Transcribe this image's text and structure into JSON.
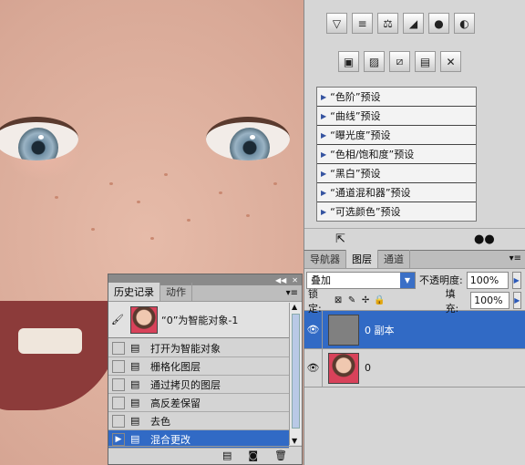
{
  "adjustments": {
    "row1_icons": [
      "levels-icon",
      "brightness-contrast-icon",
      "balance-icon",
      "curves-icon",
      "vibrance-icon",
      "color-balance-icon"
    ],
    "row2_icons": [
      "bw-icon",
      "photo-filter-icon",
      "channel-mixer-icon",
      "gradient-map-icon",
      "selective-color-icon"
    ],
    "presets": [
      "“色阶”预设",
      "“曲线”预设",
      "“曝光度”预设",
      "“色相/饱和度”预设",
      "“黑白”预设",
      "“通道混和器”预设",
      "“可选颜色”预设"
    ]
  },
  "layers_panel": {
    "tabs": [
      "导航器",
      "图层",
      "通道"
    ],
    "active_tab": "图层",
    "blend_mode": "叠加",
    "opacity_label": "不透明度:",
    "opacity_value": "100%",
    "lock_label": "锁定:",
    "fill_label": "填充:",
    "fill_value": "100%",
    "layers": [
      {
        "name": "0 副本",
        "selected": true
      },
      {
        "name": "0",
        "selected": false
      }
    ]
  },
  "history_panel": {
    "tabs": [
      "历史记录",
      "动作"
    ],
    "active_tab": "历史记录",
    "snapshot_name": "“0”为智能对象-1",
    "steps": [
      "打开为智能对象",
      "栅格化图层",
      "通过拷贝的图层",
      "高反差保留",
      "去色",
      "混合更改"
    ],
    "selected_step": "混合更改"
  },
  "colors": {
    "selection": "#316ac5",
    "panel": "#d6d6d6"
  }
}
